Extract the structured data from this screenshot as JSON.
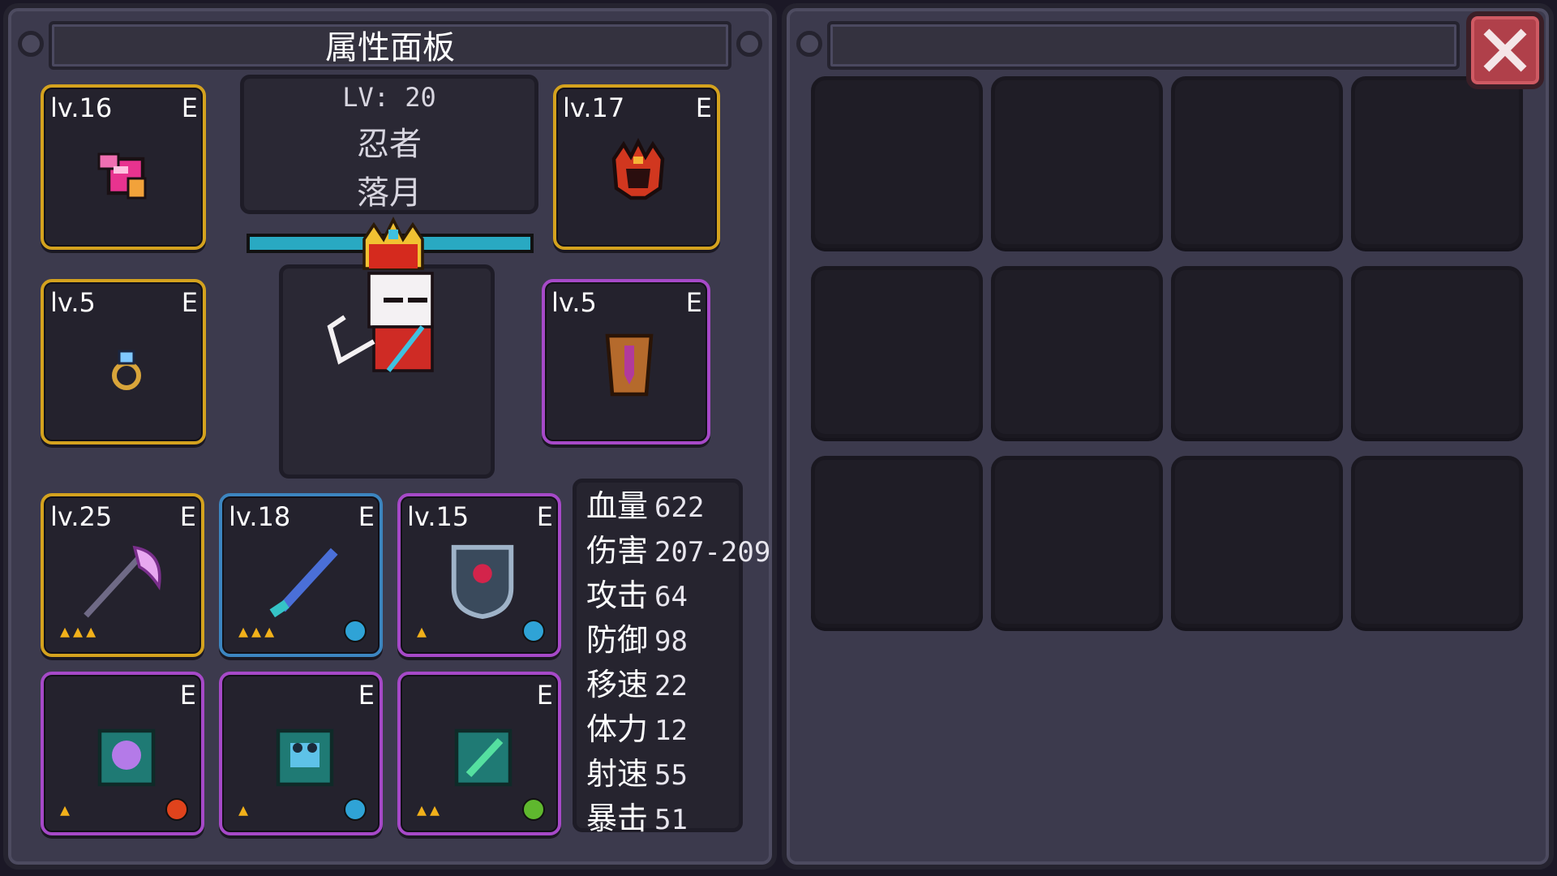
{
  "panel": {
    "title": "属性面板",
    "level_text": "LV: 20",
    "class_name": "忍者",
    "char_name": "落月",
    "hp_fill": 1.0
  },
  "equipment": [
    {
      "lv": "lv.16",
      "e": "E",
      "icon": "pink-gauntlet-icon"
    },
    {
      "lv": "lv.17",
      "e": "E",
      "icon": "crimson-helmet-icon"
    },
    {
      "lv": "lv.5",
      "e": "E",
      "icon": "sapphire-ring-icon"
    },
    {
      "lv": "lv.5",
      "e": "E",
      "icon": "bronze-armor-icon"
    },
    {
      "lv": "lv.25",
      "e": "E",
      "icon": "scythe-icon",
      "stars": "▲▲▲"
    },
    {
      "lv": "lv.18",
      "e": "E",
      "icon": "blue-sword-icon",
      "stars": "▲▲▲"
    },
    {
      "lv": "lv.15",
      "e": "E",
      "icon": "shield-icon",
      "stars": "▲"
    },
    {
      "lv": "",
      "e": "E",
      "icon": "purple-spellbook-icon",
      "stars": "▲"
    },
    {
      "lv": "",
      "e": "E",
      "icon": "frog-spellbook-icon",
      "stars": "▲"
    },
    {
      "lv": "",
      "e": "E",
      "icon": "green-spellbook-icon",
      "stars": "▲▲"
    }
  ],
  "stats": [
    {
      "label": "血量",
      "value": "622"
    },
    {
      "label": "伤害",
      "value": "207-209"
    },
    {
      "label": "攻击",
      "value": "64"
    },
    {
      "label": "防御",
      "value": "98"
    },
    {
      "label": "移速",
      "value": "22"
    },
    {
      "label": "体力",
      "value": "12"
    },
    {
      "label": "射速",
      "value": "55"
    },
    {
      "label": "暴击",
      "value": "51"
    }
  ],
  "colors": {
    "gold_rarity": "#d4a21e",
    "purple_rarity": "#a649c8",
    "blue_rarity": "#3c85c0",
    "hp_bar": "#29a9c2",
    "close_button": "#b0404a"
  },
  "inventory": {
    "cells": 12
  }
}
